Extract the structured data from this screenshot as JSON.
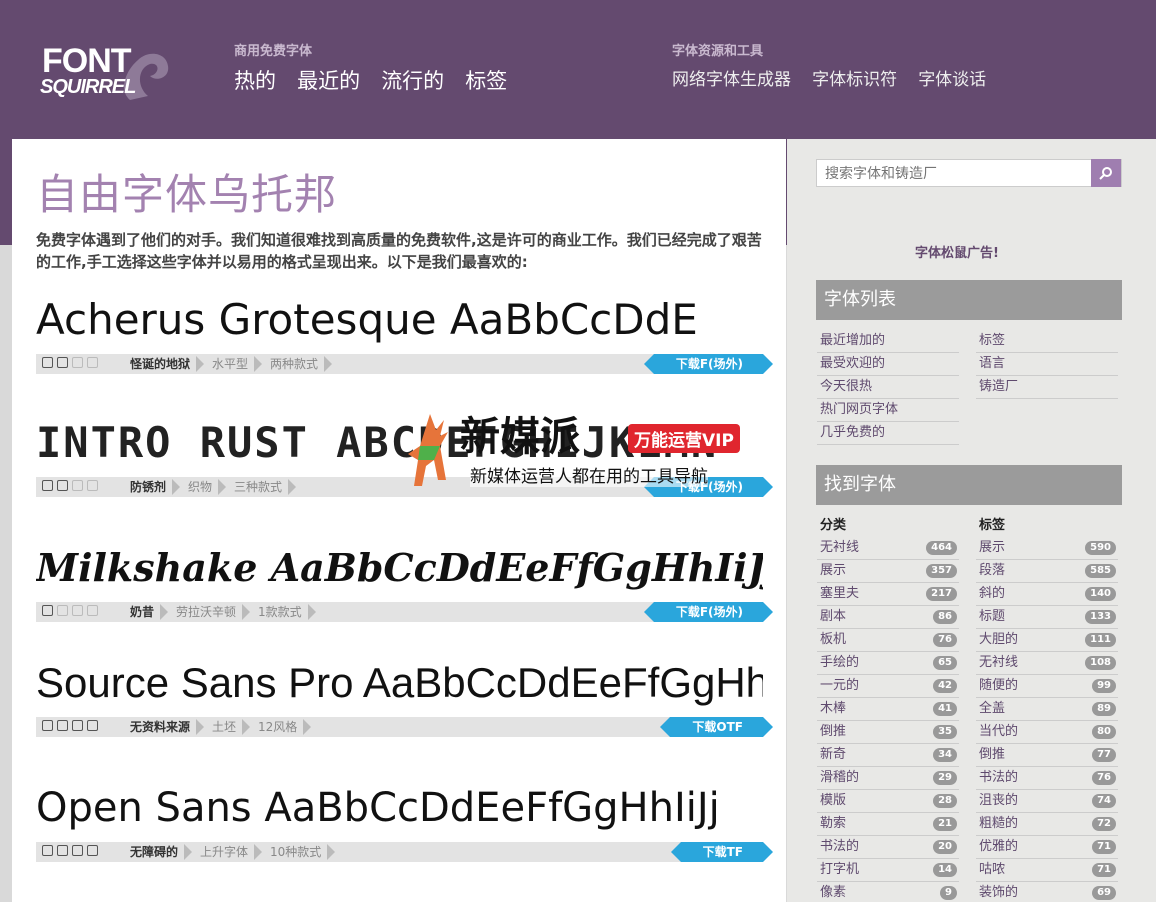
{
  "header": {
    "logo": {
      "line1": "FONT",
      "line2": "SQUIRREL"
    },
    "nav_primary": {
      "small": "商用免费字体",
      "links": [
        "热的",
        "最近的",
        "流行的",
        "标签"
      ]
    },
    "nav_tools": {
      "small": "字体资源和工具",
      "links": [
        "网络字体生成器",
        "字体标识符",
        "字体谈话"
      ]
    }
  },
  "main": {
    "title": "自由字体乌托邦",
    "intro": "免费字体遇到了他们的对手。我们知道很难找到高质量的免费软件,这是许可的商业工作。我们已经完成了艰苦的工作,手工选择这些字体并以易用的格式呈现出来。以下是我们最喜欢的:",
    "fonts": [
      {
        "sample": "Acherus Grotesque AaBbCcDdE",
        "tags": [
          "怪诞的地狱",
          "水平型",
          "两种款式"
        ],
        "download": "下载F(场外)",
        "icons": [
          true,
          true,
          false,
          false
        ]
      },
      {
        "sample": "INTRO RUST ABCDEFGHIJKLMN",
        "tags": [
          "防锈剂",
          "织物",
          "三种款式"
        ],
        "download": "下载F(场外)",
        "icons": [
          true,
          true,
          false,
          false
        ]
      },
      {
        "sample": "Milkshake AaBbCcDdEeFfGgHhIiJj",
        "tags": [
          "奶昔",
          "劳拉沃辛顿",
          "1款款式"
        ],
        "download": "下载F(场外)",
        "icons": [
          true,
          false,
          false,
          false
        ]
      },
      {
        "sample": "Source Sans Pro AaBbCcDdEeFfGgHh",
        "tags": [
          "无资料来源",
          "土坯",
          "12风格"
        ],
        "download": "下载OTF",
        "icons": [
          true,
          true,
          true,
          true
        ]
      },
      {
        "sample": "Open Sans AaBbCcDdEeFfGgHhIiJj",
        "tags": [
          "无障碍的",
          "上升字体",
          "10种款式"
        ],
        "download": "下载TF",
        "icons": [
          true,
          true,
          true,
          true
        ]
      }
    ],
    "watermark": {
      "brand": "新媒派",
      "badge": "万能运营VIP",
      "tagline": "新媒体运营人都在用的工具导航"
    }
  },
  "sidebar": {
    "search": {
      "placeholder": "搜索字体和铸造厂"
    },
    "ad_label": "字体松鼠广告!",
    "font_list": {
      "heading": "字体列表",
      "left": [
        "最近增加的",
        "最受欢迎的",
        "今天很热",
        "热门网页字体",
        "几乎免费的"
      ],
      "right": [
        "标签",
        "语言",
        "铸造厂"
      ]
    },
    "find_fonts": {
      "heading": "找到字体",
      "categories_heading": "分类",
      "tags_heading": "标签",
      "categories": [
        {
          "name": "无衬线",
          "count": "464"
        },
        {
          "name": "展示",
          "count": "357"
        },
        {
          "name": "塞里夫",
          "count": "217"
        },
        {
          "name": "剧本",
          "count": "86"
        },
        {
          "name": "板机",
          "count": "76"
        },
        {
          "name": "手绘的",
          "count": "65"
        },
        {
          "name": "一元的",
          "count": "42"
        },
        {
          "name": "木棒",
          "count": "41"
        },
        {
          "name": "倒推",
          "count": "35"
        },
        {
          "name": "新奇",
          "count": "34"
        },
        {
          "name": "滑稽的",
          "count": "29"
        },
        {
          "name": "模版",
          "count": "28"
        },
        {
          "name": "勒索",
          "count": "21"
        },
        {
          "name": "书法的",
          "count": "20"
        },
        {
          "name": "打字机",
          "count": "14"
        },
        {
          "name": "像素",
          "count": "9"
        }
      ],
      "tags": [
        {
          "name": "展示",
          "count": "590"
        },
        {
          "name": "段落",
          "count": "585"
        },
        {
          "name": "斜的",
          "count": "140"
        },
        {
          "name": "标题",
          "count": "133"
        },
        {
          "name": "大胆的",
          "count": "111"
        },
        {
          "name": "无衬线",
          "count": "108"
        },
        {
          "name": "随便的",
          "count": "99"
        },
        {
          "name": "全盖",
          "count": "89"
        },
        {
          "name": "当代的",
          "count": "80"
        },
        {
          "name": "倒推",
          "count": "77"
        },
        {
          "name": "书法的",
          "count": "76"
        },
        {
          "name": "沮丧的",
          "count": "74"
        },
        {
          "name": "粗糙的",
          "count": "72"
        },
        {
          "name": "优雅的",
          "count": "71"
        },
        {
          "name": "咕哝",
          "count": "71"
        },
        {
          "name": "装饰的",
          "count": "69"
        }
      ]
    }
  }
}
